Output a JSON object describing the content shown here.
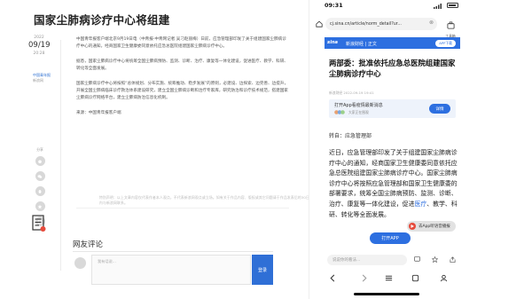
{
  "desktop": {
    "title": "国家尘肺病诊疗中心将组建",
    "date": {
      "year": "2022",
      "month_day": "09/19",
      "time": "20:28"
    },
    "source": {
      "name": "中国青年报",
      "label": "新浪网"
    },
    "paragraphs": [
      "中国青年报客户端北京9月19日电（中青报·中青网记者 吴刁赵丽梅）日前，应急管理部印发了关于组建国家尘肺病诊疗中心的通知，经商国家卫生健康委同意依托应急总医院组建国家尘肺病诊疗中心。",
      "据悉，国家尘肺病诊疗中心将统筹全国尘肺病预防、监测、诊断、治疗、康复等一体化建设，促进医疗、教学、科研、转化等全面发展。",
      "国家尘肺病诊疗中心将按照“总体规划、分布实施、统筹推动、稳步发展”的原则，必建设、边探索、边完善、边提升，开展全国尘肺病临床诊疗救治体系建设研究，建立全国尘肺病诊断和治疗专家库，研究防治和诊疗技术规范，搭建国家尘肺病诊疗网络平台，建立尘肺病防治信息化机制。",
      "来源：中国青年报客户端"
    ],
    "side_labels": [
      "分享"
    ],
    "footnote": "特别声明：以上文章内容仅代表作者本人观点，不代表新浪网观点或立场。如有关于作品内容、版权或其它问题请于作品发表后的30日内与新浪网联系。",
    "comments": {
      "title": "网友评论",
      "placeholder": "我有话说…",
      "submit": "登录"
    }
  },
  "phone": {
    "status_time": "09:31",
    "url": "cj.sina.cn/article/norm_detail?ur...",
    "tool_label": "工具箱",
    "channel": {
      "logo": "sina",
      "breadcrumb": "新浪财经 | 正文",
      "app_button": "APP下载"
    },
    "headline": "两部委：批准依托应急总医院组建国家尘肺病诊疗中心",
    "meta": "新浪财经 2022-09-19 19:41",
    "promo": {
      "text": "打开App看疫情最新消息",
      "sub": "大家正在围观",
      "button": "详情"
    },
    "repost": "转自：应急管理部",
    "article_parts": [
      {
        "text": "近日，应急管理部印发了关于组建国家尘肺病诊疗中心的通知，经商国家卫生健康委同意依托应急总医院组建国家尘肺病诊疗中心。国家尘肺病诊疗中心将按照应急管理部和国家卫生健康委的部署要求，统筹全国尘肺病预防、监测、诊断、治疗、康复等一体化建设，促进",
        "hl": false
      },
      {
        "text": "医疗",
        "hl": true
      },
      {
        "text": "、教学、科研、转化等全面发展。",
        "hl": false
      }
    ],
    "toast": "去App听语音播报",
    "open_app": "打开APP",
    "comment_placeholder": "说说你的看法..."
  }
}
